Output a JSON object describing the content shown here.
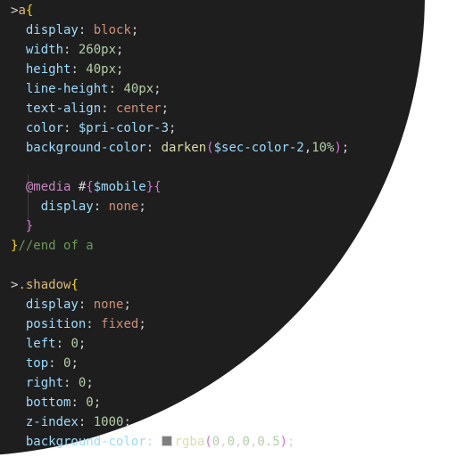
{
  "code": {
    "lines": [
      {
        "tokens": [
          {
            "t": ">",
            "k": "punct"
          },
          {
            "t": "a",
            "k": "tag"
          },
          {
            "t": "{",
            "k": "br1"
          }
        ]
      },
      {
        "tokens": [
          {
            "t": "  "
          },
          {
            "t": "display",
            "k": "prop"
          },
          {
            "t": ": ",
            "k": "punct"
          },
          {
            "t": "block",
            "k": "val"
          },
          {
            "t": ";",
            "k": "punct"
          }
        ]
      },
      {
        "tokens": [
          {
            "t": "  "
          },
          {
            "t": "width",
            "k": "prop"
          },
          {
            "t": ": ",
            "k": "punct"
          },
          {
            "t": "260px",
            "k": "num"
          },
          {
            "t": ";",
            "k": "punct"
          }
        ]
      },
      {
        "tokens": [
          {
            "t": "  "
          },
          {
            "t": "height",
            "k": "prop"
          },
          {
            "t": ": ",
            "k": "punct"
          },
          {
            "t": "40px",
            "k": "num"
          },
          {
            "t": ";",
            "k": "punct"
          }
        ]
      },
      {
        "tokens": [
          {
            "t": "  "
          },
          {
            "t": "line-height",
            "k": "prop"
          },
          {
            "t": ": ",
            "k": "punct"
          },
          {
            "t": "40px",
            "k": "num"
          },
          {
            "t": ";",
            "k": "punct"
          }
        ]
      },
      {
        "tokens": [
          {
            "t": "  "
          },
          {
            "t": "text-align",
            "k": "prop"
          },
          {
            "t": ": ",
            "k": "punct"
          },
          {
            "t": "center",
            "k": "val"
          },
          {
            "t": ";",
            "k": "punct"
          }
        ]
      },
      {
        "tokens": [
          {
            "t": "  "
          },
          {
            "t": "color",
            "k": "prop"
          },
          {
            "t": ": ",
            "k": "punct"
          },
          {
            "t": "$pri-color-3",
            "k": "var"
          },
          {
            "t": ";",
            "k": "punct"
          }
        ]
      },
      {
        "tokens": [
          {
            "t": "  "
          },
          {
            "t": "background-color",
            "k": "prop"
          },
          {
            "t": ": ",
            "k": "punct"
          },
          {
            "t": "darken",
            "k": "fn"
          },
          {
            "t": "(",
            "k": "br2"
          },
          {
            "t": "$sec-color-2",
            "k": "var"
          },
          {
            "t": ",",
            "k": "punct"
          },
          {
            "t": "10%",
            "k": "num"
          },
          {
            "t": ")",
            "k": "br2"
          },
          {
            "t": ";",
            "k": "punct"
          }
        ]
      },
      {
        "tokens": []
      },
      {
        "tokens": [
          {
            "t": "  "
          },
          {
            "t": "@media",
            "k": "at"
          },
          {
            "t": " #",
            "k": "punct"
          },
          {
            "t": "{",
            "k": "br2"
          },
          {
            "t": "$mobile",
            "k": "var"
          },
          {
            "t": "}",
            "k": "br2"
          },
          {
            "t": "{",
            "k": "br2"
          }
        ]
      },
      {
        "tokens": [
          {
            "t": "    "
          },
          {
            "t": "display",
            "k": "prop"
          },
          {
            "t": ": ",
            "k": "punct"
          },
          {
            "t": "none",
            "k": "val"
          },
          {
            "t": ";",
            "k": "punct"
          }
        ]
      },
      {
        "tokens": [
          {
            "t": "  "
          },
          {
            "t": "}",
            "k": "br2"
          }
        ]
      },
      {
        "tokens": [
          {
            "t": "}",
            "k": "br1"
          },
          {
            "t": "//end of a",
            "k": "comment"
          }
        ]
      },
      {
        "tokens": []
      },
      {
        "tokens": [
          {
            "t": ">",
            "k": "punct"
          },
          {
            "t": ".shadow",
            "k": "tag"
          },
          {
            "t": "{",
            "k": "br1"
          }
        ]
      },
      {
        "tokens": [
          {
            "t": "  "
          },
          {
            "t": "display",
            "k": "prop"
          },
          {
            "t": ": ",
            "k": "punct"
          },
          {
            "t": "none",
            "k": "val"
          },
          {
            "t": ";",
            "k": "punct"
          }
        ]
      },
      {
        "tokens": [
          {
            "t": "  "
          },
          {
            "t": "position",
            "k": "prop"
          },
          {
            "t": ": ",
            "k": "punct"
          },
          {
            "t": "fixed",
            "k": "val"
          },
          {
            "t": ";",
            "k": "punct"
          }
        ]
      },
      {
        "tokens": [
          {
            "t": "  "
          },
          {
            "t": "left",
            "k": "prop"
          },
          {
            "t": ": ",
            "k": "punct"
          },
          {
            "t": "0",
            "k": "num"
          },
          {
            "t": ";",
            "k": "punct"
          }
        ]
      },
      {
        "tokens": [
          {
            "t": "  "
          },
          {
            "t": "top",
            "k": "prop"
          },
          {
            "t": ": ",
            "k": "punct"
          },
          {
            "t": "0",
            "k": "num"
          },
          {
            "t": ";",
            "k": "punct"
          }
        ]
      },
      {
        "tokens": [
          {
            "t": "  "
          },
          {
            "t": "right",
            "k": "prop"
          },
          {
            "t": ": ",
            "k": "punct"
          },
          {
            "t": "0",
            "k": "num"
          },
          {
            "t": ";",
            "k": "punct"
          }
        ]
      },
      {
        "tokens": [
          {
            "t": "  "
          },
          {
            "t": "bottom",
            "k": "prop"
          },
          {
            "t": ": ",
            "k": "punct"
          },
          {
            "t": "0",
            "k": "num"
          },
          {
            "t": ";",
            "k": "punct"
          }
        ]
      },
      {
        "tokens": [
          {
            "t": "  "
          },
          {
            "t": "z-index",
            "k": "prop"
          },
          {
            "t": ": ",
            "k": "punct"
          },
          {
            "t": "1000",
            "k": "num"
          },
          {
            "t": ";",
            "k": "punct"
          }
        ]
      },
      {
        "tokens": [
          {
            "t": "  "
          },
          {
            "t": "background-color",
            "k": "prop"
          },
          {
            "t": ": ",
            "k": "punct"
          },
          {
            "t": "",
            "k": "swatch"
          },
          {
            "t": "rgba",
            "k": "fn"
          },
          {
            "t": "(",
            "k": "br2"
          },
          {
            "t": "0",
            "k": "num"
          },
          {
            "t": ",",
            "k": "punct"
          },
          {
            "t": "0",
            "k": "num"
          },
          {
            "t": ",",
            "k": "punct"
          },
          {
            "t": "0",
            "k": "num"
          },
          {
            "t": ",",
            "k": "punct"
          },
          {
            "t": "0.5",
            "k": "num"
          },
          {
            "t": ")",
            "k": "br2"
          },
          {
            "t": ";",
            "k": "punct"
          }
        ]
      }
    ]
  },
  "colors": {
    "editor_background": "#1e1e1e",
    "page_background": "#ffffff",
    "swatch_value": "rgba(0,0,0,0.5)"
  }
}
